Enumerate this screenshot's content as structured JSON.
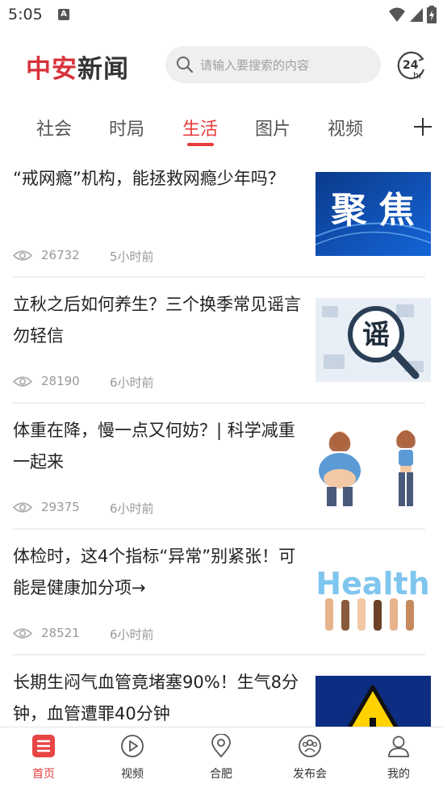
{
  "status_bar": {
    "time": "5:05",
    "notification_badge": "A",
    "icons": [
      "wifi-icon",
      "signal-icon",
      "battery-charging-icon"
    ]
  },
  "header": {
    "logo_part1": "中安",
    "logo_part2": "新闻",
    "brand_color": "#d8323a",
    "search_placeholder": "请输入要搜索的内容",
    "hr24_label": "24",
    "hr24_sub": "hr"
  },
  "tabs": {
    "items": [
      "社会",
      "时局",
      "生活",
      "图片",
      "视频"
    ],
    "active_index": 2,
    "active_color": "#e83c3c"
  },
  "feed": {
    "items": [
      {
        "title": "“戒网瘾”机构，能拯救网瘾少年吗？",
        "views": "26732",
        "time": "5小时前",
        "thumb_text": "聚 焦"
      },
      {
        "title": "立秋之后如何养生？三个换季常见谣言勿轻信",
        "views": "28190",
        "time": "6小时前",
        "thumb_text": "谣"
      },
      {
        "title": "体重在降，慢一点又何妨？| 科学减重一起来",
        "views": "29375",
        "time": "6小时前",
        "thumb_text": ""
      },
      {
        "title": "体检时，这4个指标“异常”别紧张！可能是健康加分项→",
        "views": "28521",
        "time": "6小时前",
        "thumb_text": "Health"
      },
      {
        "title": "长期生闷气血管竟堵塞90%！生气8分钟，血管遭罪40分钟",
        "views": "",
        "time": "",
        "thumb_text": "!"
      }
    ]
  },
  "bottom_nav": {
    "items": [
      {
        "label": "首页",
        "icon": "home-icon"
      },
      {
        "label": "视频",
        "icon": "play-icon"
      },
      {
        "label": "合肥",
        "icon": "location-icon"
      },
      {
        "label": "发布会",
        "icon": "group-icon"
      },
      {
        "label": "我的",
        "icon": "user-icon"
      }
    ],
    "active_index": 0
  }
}
